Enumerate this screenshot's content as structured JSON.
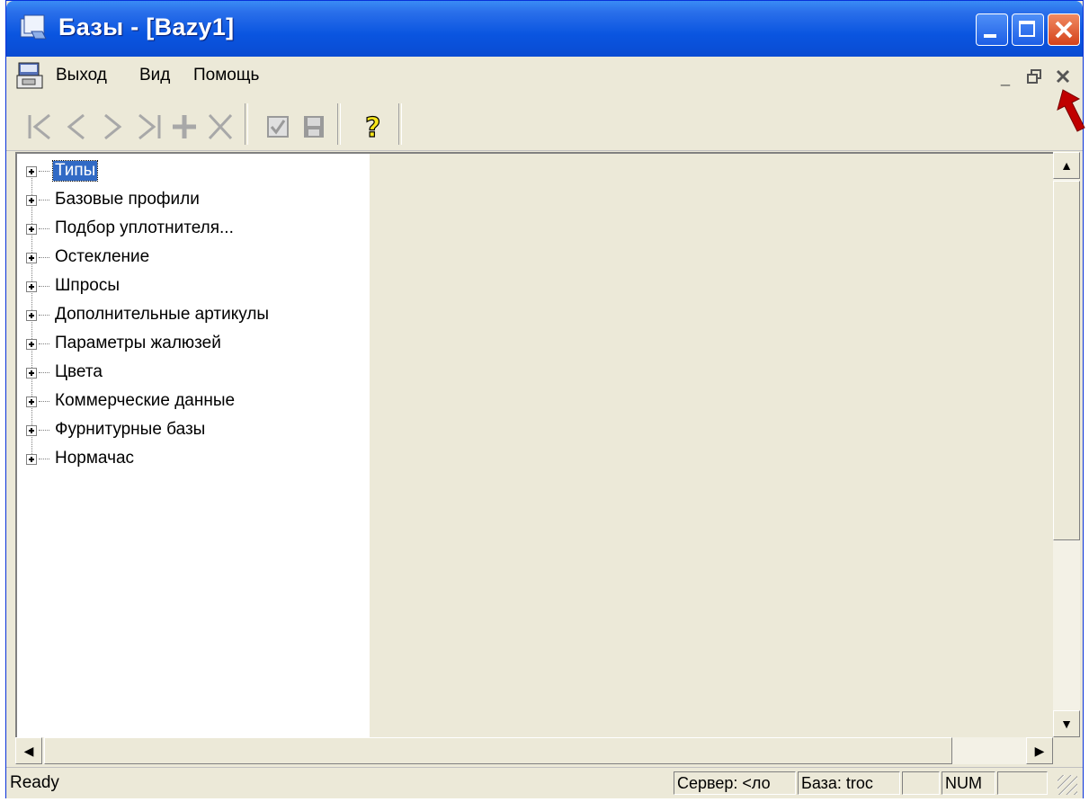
{
  "window": {
    "title": "Базы - [Bazy1]"
  },
  "menubar": {
    "items": [
      "Выход",
      "Вид",
      "Помощь"
    ]
  },
  "toolbar": {
    "buttons": [
      "first-icon",
      "prev-icon",
      "next-icon",
      "last-icon",
      "add-icon",
      "delete-icon",
      "check-icon",
      "save-icon",
      "help-icon"
    ]
  },
  "tree": {
    "items": [
      {
        "label": "Типы",
        "selected": true
      },
      {
        "label": "Базовые профили"
      },
      {
        "label": "Подбор уплотнителя..."
      },
      {
        "label": "Остекление"
      },
      {
        "label": "Шпросы"
      },
      {
        "label": "Дополнительные артикулы"
      },
      {
        "label": "Параметры жалюзей"
      },
      {
        "label": "Цвета"
      },
      {
        "label": "Коммерческие данные"
      },
      {
        "label": "Фурнитурные базы"
      },
      {
        "label": "Нормачас"
      }
    ]
  },
  "statusbar": {
    "text": "Ready",
    "server": "Сервер: <ло",
    "base": "База: troc",
    "num": "NUM"
  },
  "colors": {
    "titlebar": "#0a55e0",
    "selection": "#316ac5",
    "annotation_arrow": "#c00000"
  }
}
